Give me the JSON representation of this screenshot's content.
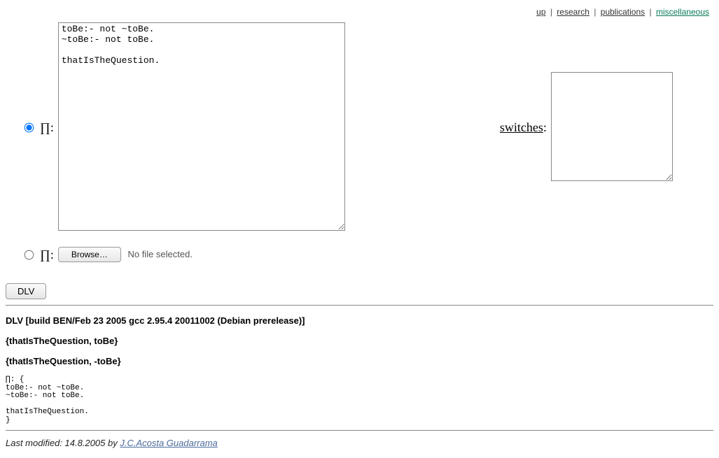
{
  "nav": {
    "up": "up",
    "research": "research",
    "publications": "publications",
    "miscellaneous": "miscellaneous",
    "sep": " | "
  },
  "form": {
    "pi_label": "∏:",
    "program_text": "toBe:- not ~toBe.\n~toBe:- not toBe.\n\nthatIsTheQuestion.",
    "switches_label": "switches",
    "switches_colon": ":",
    "switches_text": "",
    "browse_button": "Browse…",
    "no_file": "No file selected.",
    "submit_button": "DLV"
  },
  "output": {
    "build": "DLV [build BEN/Feb 23 2005 gcc 2.95.4 20011002 (Debian prerelease)]",
    "model1": "{thatIsTheQuestion, toBe}",
    "model2": "{thatIsTheQuestion, -toBe}",
    "echo": "∏: {\ntoBe:- not ~toBe.\n~toBe:- not toBe.\n\nthatIsTheQuestion.\n}"
  },
  "footer": {
    "prefix": "Last modified: 14.8.2005 by ",
    "author": "J.C.Acosta Guadarrama"
  }
}
